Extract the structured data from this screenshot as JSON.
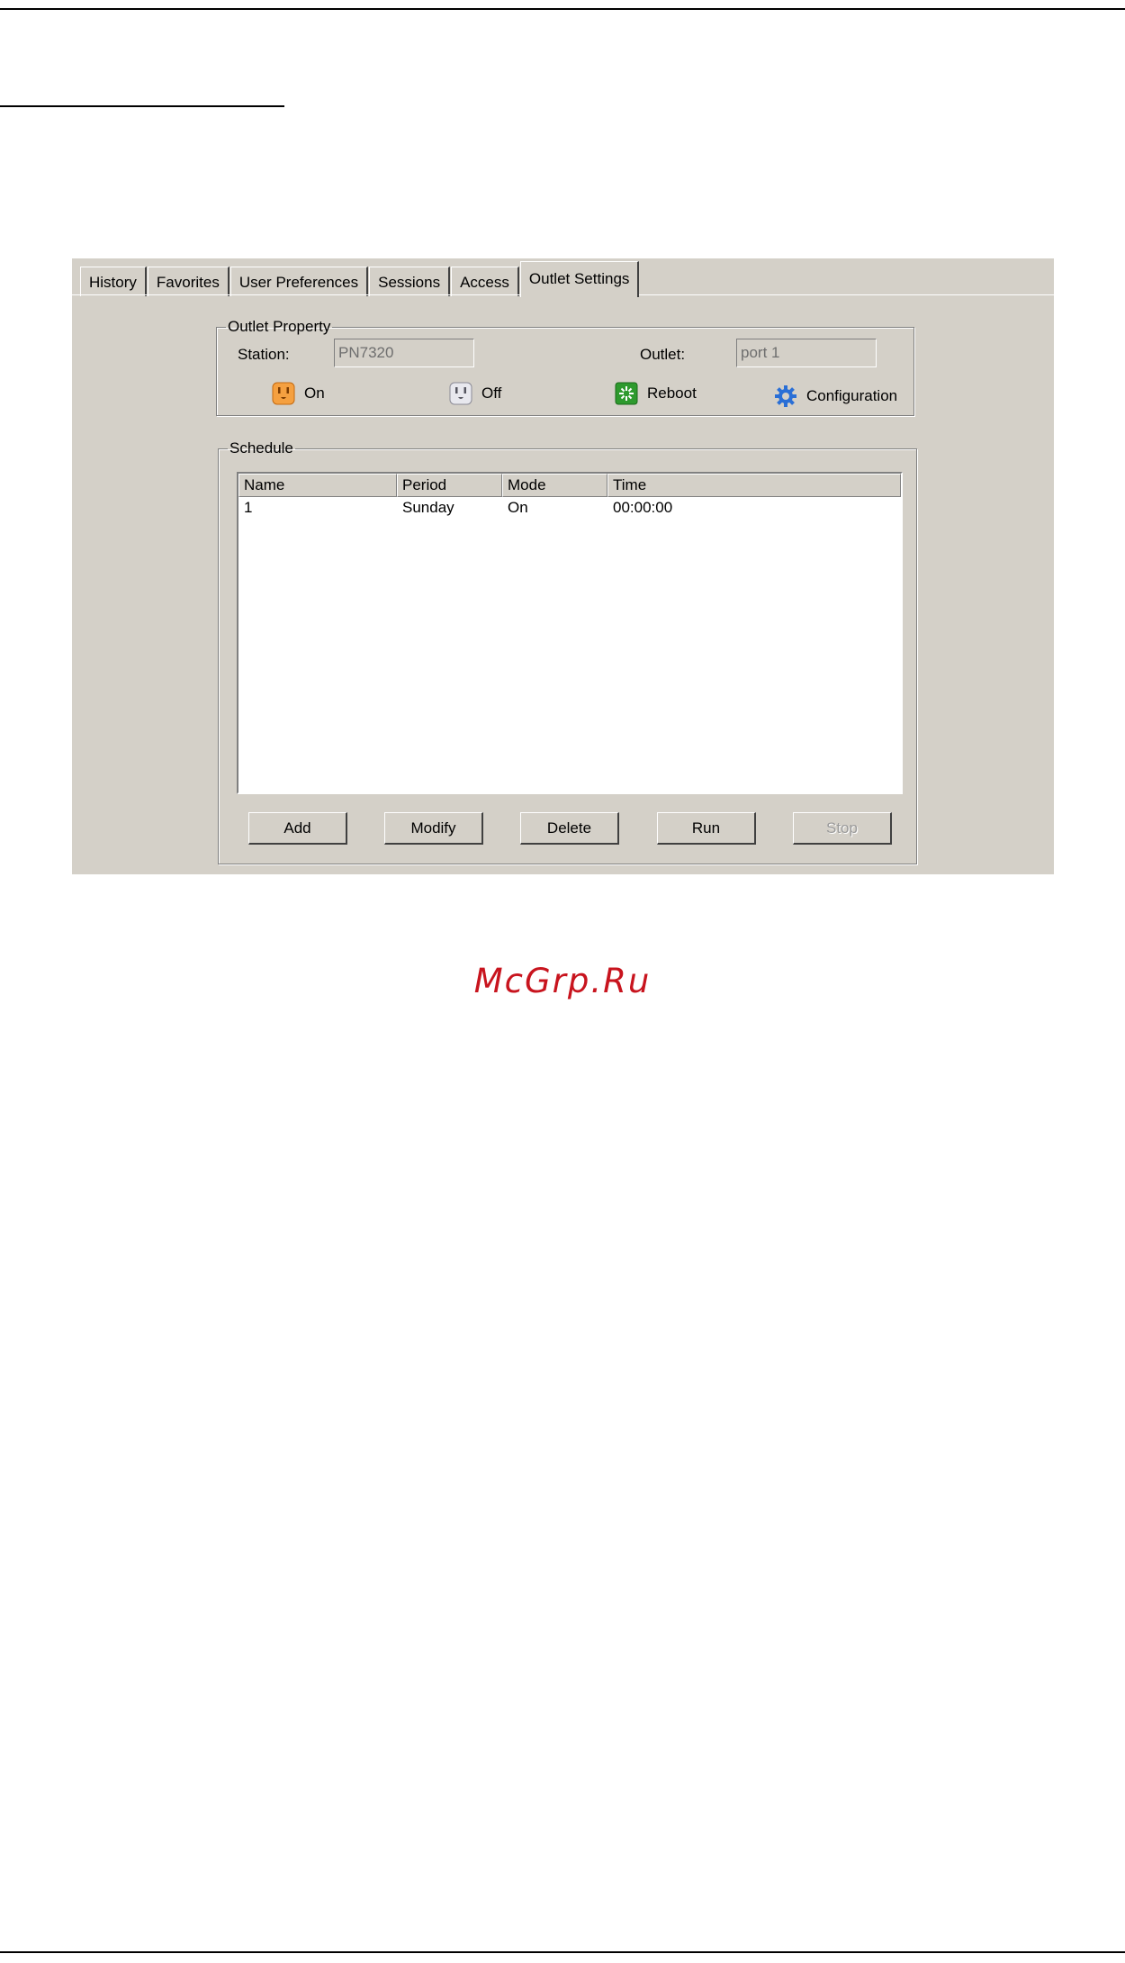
{
  "tabs": [
    {
      "label": "History",
      "active": false
    },
    {
      "label": "Favorites",
      "active": false
    },
    {
      "label": "User Preferences",
      "active": false
    },
    {
      "label": "Sessions",
      "active": false
    },
    {
      "label": "Access",
      "active": false
    },
    {
      "label": "Outlet Settings",
      "active": true
    }
  ],
  "outlet_property": {
    "legend": "Outlet Property",
    "station_label": "Station:",
    "station_value": "PN7320",
    "outlet_label": "Outlet:",
    "outlet_value": "port 1",
    "actions": {
      "on": {
        "label": "On",
        "icon": "outlet-on-icon"
      },
      "off": {
        "label": "Off",
        "icon": "outlet-off-icon"
      },
      "reboot": {
        "label": "Reboot",
        "icon": "reboot-icon"
      },
      "configuration": {
        "label": "Configuration",
        "icon": "gear-icon"
      }
    }
  },
  "schedule": {
    "legend": "Schedule",
    "columns": [
      "Name",
      "Period",
      "Mode",
      "Time"
    ],
    "rows": [
      [
        "1",
        "Sunday",
        "On",
        "00:00:00"
      ]
    ],
    "buttons": {
      "add": "Add",
      "modify": "Modify",
      "delete": "Delete",
      "run": "Run",
      "stop": "Stop"
    },
    "stop_enabled": false
  },
  "watermark": "McGrp.Ru",
  "colors": {
    "panel_bg": "#d4d0c8",
    "on_icon": "#f5a040",
    "reboot_icon": "#2e9a2e",
    "gear_icon": "#2a6fd6",
    "watermark": "#c8141e"
  }
}
